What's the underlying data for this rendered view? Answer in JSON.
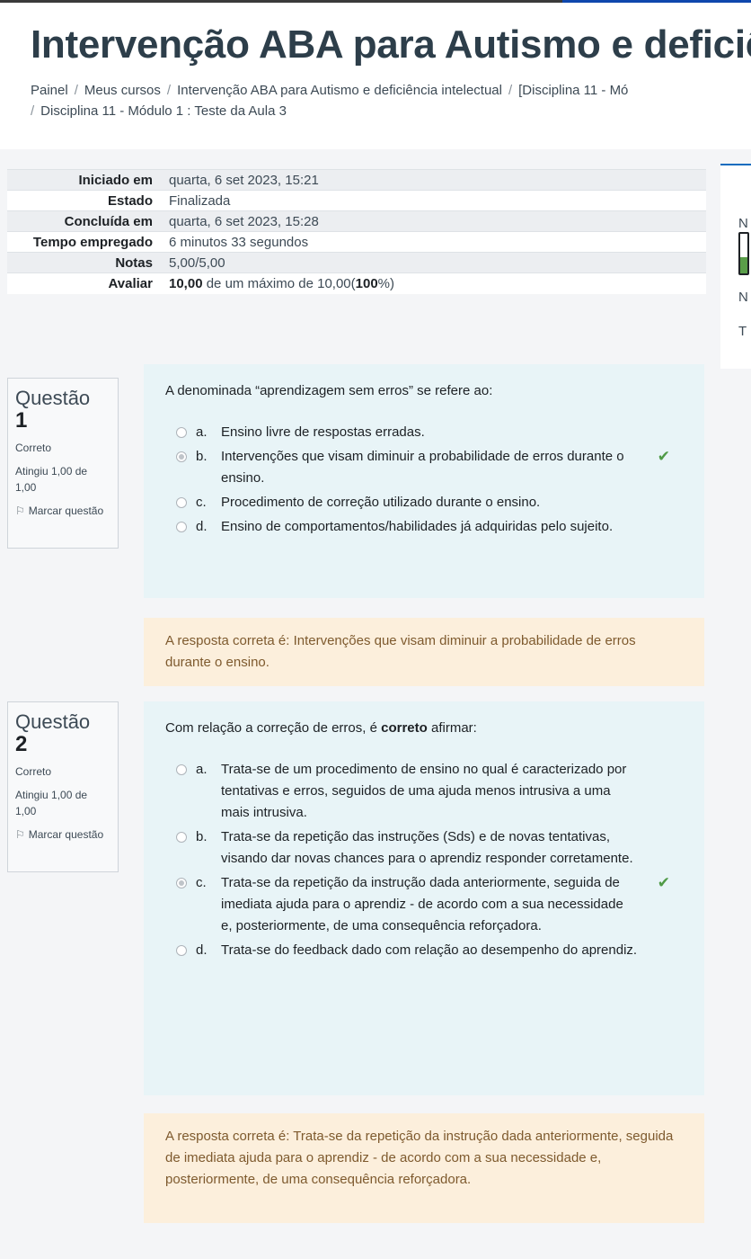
{
  "page": {
    "title": "Intervenção ABA para Autismo e deficiê",
    "breadcrumb": [
      "Painel",
      "Meus cursos",
      "Intervenção ABA para Autismo e deficiência intelectual",
      "[Disciplina 11 - Mó",
      "Disciplina 11 - Módulo 1 : Teste da Aula 3"
    ]
  },
  "summary": {
    "rows": [
      {
        "label": "Iniciado em",
        "value": "quarta, 6 set 2023, 15:21"
      },
      {
        "label": "Estado",
        "value": "Finalizada"
      },
      {
        "label": "Concluída em",
        "value": "quarta, 6 set 2023, 15:28"
      },
      {
        "label": "Tempo empregado",
        "value": "6 minutos 33 segundos"
      },
      {
        "label": "Notas",
        "value": "5,00/5,00"
      }
    ],
    "grade": {
      "label": "Avaliar",
      "score": "10,00",
      "middle": " de um máximo de 10,00(",
      "percent": "100",
      "end": "%)"
    }
  },
  "side_block": {
    "letters": [
      "N",
      "N",
      "T"
    ],
    "progress_fraction": 0.4,
    "progress_color": "#5a9e49"
  },
  "questions": [
    {
      "word": "Questão",
      "number": "1",
      "state": "Correto",
      "grade": "Atingiu 1,00 de 1,00",
      "flag": "Marcar questão",
      "text": "A denominada “aprendizagem sem erros” se refere ao:",
      "answers": [
        {
          "letter": "a.",
          "text": "Ensino livre de respostas erradas."
        },
        {
          "letter": "b.",
          "text": "Intervenções que visam diminuir a probabilidade de erros durante o ensino."
        },
        {
          "letter": "c.",
          "text": "Procedimento de correção utilizado durante o ensino."
        },
        {
          "letter": "d.",
          "text": "Ensino de comportamentos/habilidades já adquiridas pelo sujeito."
        }
      ],
      "selected": 1,
      "feedback": "A resposta correta é: Intervenções que visam diminuir a probabilidade de erros durante o ensino."
    },
    {
      "word": "Questão",
      "number": "2",
      "state": "Correto",
      "grade": "Atingiu 1,00 de 1,00",
      "flag": "Marcar questão",
      "text_before": "Com relação a correção de erros, é ",
      "text_bold": "correto",
      "text_after": " afirmar:",
      "answers": [
        {
          "letter": "a.",
          "text": "Trata-se de um procedimento de ensino no qual é caracterizado por tentativas e erros, seguidos de uma ajuda menos intrusiva a uma mais intrusiva."
        },
        {
          "letter": "b.",
          "text": "Trata-se da repetição das instruções (Sds) e de novas tentativas, visando dar novas chances para o aprendiz responder corretamente."
        },
        {
          "letter": "c.",
          "text": "Trata-se da repetição da instrução dada anteriormente, seguida de imediata ajuda para o aprendiz - de acordo com a sua necessidade e, posteriormente, de uma consequência reforçadora."
        },
        {
          "letter": "d.",
          "text": "Trata-se do feedback dado com relação ao desempenho do aprendiz."
        }
      ],
      "selected": 2,
      "feedback": "A resposta correta é: Trata-se da repetição da instrução dada anteriormente, seguida de imediata ajuda para o aprendiz - de acordo com a sua necessidade e, posteriormente, de uma consequência reforçadora."
    }
  ],
  "icons": {
    "check": "✔",
    "flag": "⚐"
  },
  "colors": {
    "correct": "#4f9a46",
    "formulation_bg": "#e8f4f7",
    "outcome_bg": "#fcefdc",
    "outcome_text": "#7e5a2e"
  }
}
